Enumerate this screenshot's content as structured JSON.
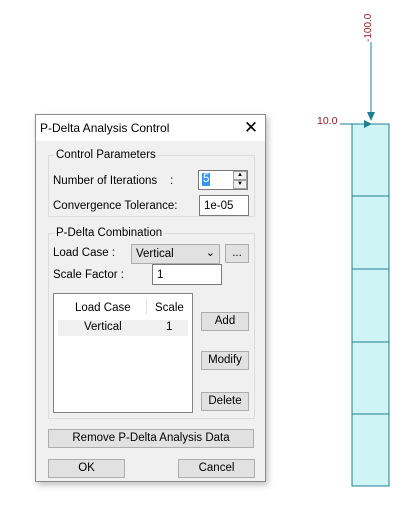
{
  "canvas": {
    "top_load_label": "-100.0",
    "side_load_label": "10.0",
    "member_color": "#cff4f6",
    "line_color": "#1f7f90",
    "top_label_color": "#8b1a1a",
    "side_label_color": "#8b1a1a"
  },
  "dialog": {
    "title": "P-Delta Analysis Control",
    "close_icon": "close-icon",
    "control_group": {
      "legend": "Control Parameters",
      "iterations_label": "Number of Iterations",
      "iterations_colon": ":",
      "iterations_value": "5",
      "tolerance_label": "Convergence Tolerance:",
      "tolerance_value": "1e-05"
    },
    "combination_group": {
      "legend": "P-Delta Combination",
      "load_case_label": "Load Case :",
      "load_case_selected": "Vertical",
      "browse_label": "...",
      "scale_factor_label": "Scale Factor :",
      "scale_factor_value": "1",
      "list_headers": [
        "Load Case",
        "Scale"
      ],
      "rows": [
        {
          "load_case": "Vertical",
          "scale": "1"
        }
      ],
      "add_label": "Add",
      "modify_label": "Modify",
      "delete_label": "Delete"
    },
    "remove_label": "Remove P-Delta Analysis Data",
    "ok_label": "OK",
    "cancel_label": "Cancel"
  }
}
